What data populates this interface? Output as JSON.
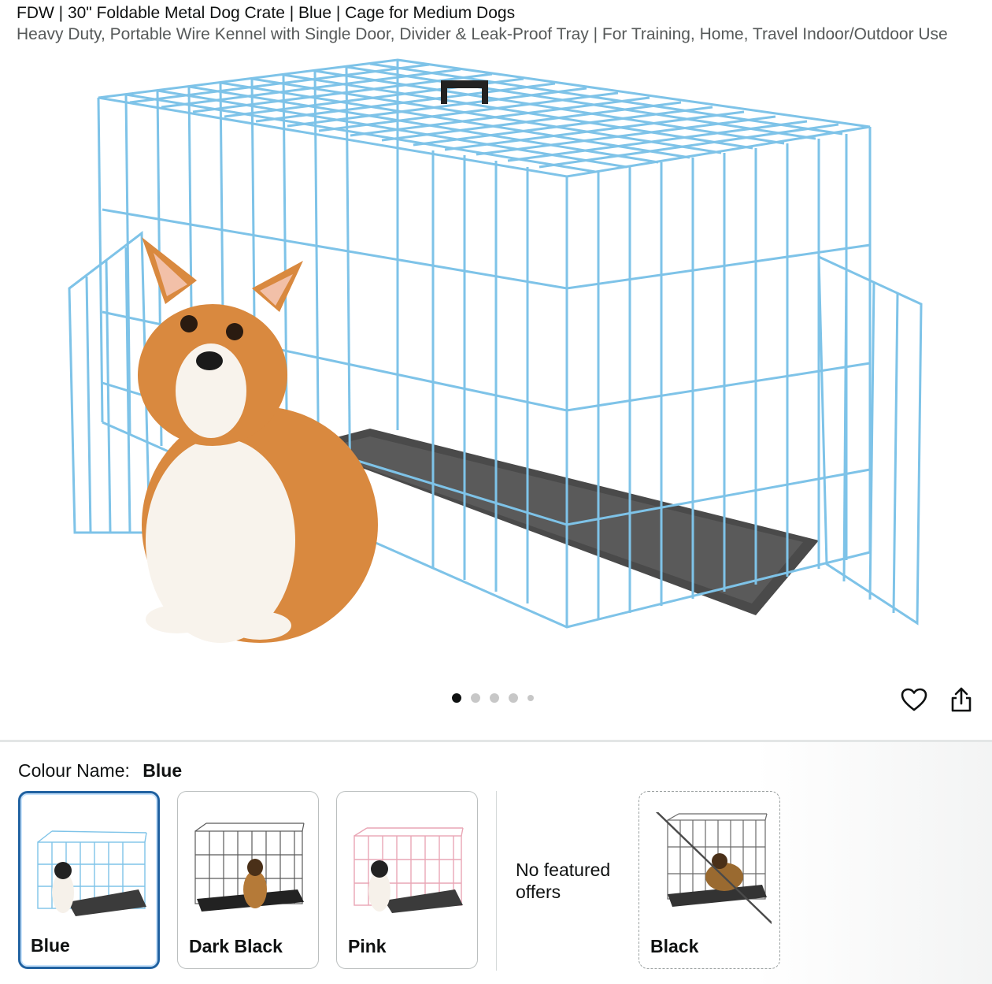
{
  "product": {
    "title": "FDW | 30\" Foldable Metal Dog Crate | Blue | Cage for Medium Dogs",
    "subtitle": "Heavy Duty, Portable Wire Kennel with Single Door, Divider & Leak-Proof Tray | For Training, Home, Travel Indoor/Outdoor Use"
  },
  "gallery": {
    "image_count": 5,
    "active_index": 0,
    "icons": {
      "wishlist": "heart-icon",
      "share": "share-icon"
    }
  },
  "variation": {
    "label": "Colour Name:",
    "selected": "Blue",
    "options": [
      {
        "name": "Blue",
        "selected": true,
        "available": true
      },
      {
        "name": "Dark Black",
        "selected": false,
        "available": true
      },
      {
        "name": "Pink",
        "selected": false,
        "available": true
      },
      {
        "name": "Black",
        "selected": false,
        "available": false
      }
    ],
    "no_offers_text": "No featured offers"
  },
  "colors": {
    "selected_border": "#2162a1",
    "crate_blue": "#7ec3e8",
    "crate_pink": "#e9a6b5",
    "crate_black": "#3a3a3a",
    "text": "#0f1111"
  }
}
